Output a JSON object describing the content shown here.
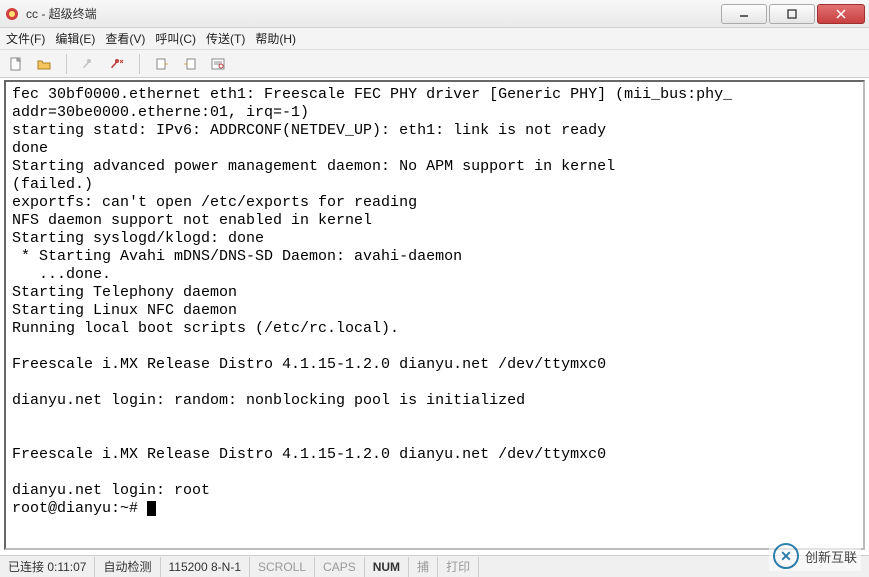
{
  "window": {
    "title": "cc - 超级终端"
  },
  "menu": {
    "file": "文件(F)",
    "edit": "编辑(E)",
    "view": "查看(V)",
    "call": "呼叫(C)",
    "transfer": "传送(T)",
    "help": "帮助(H)"
  },
  "terminal": {
    "content": "fec 30bf0000.ethernet eth1: Freescale FEC PHY driver [Generic PHY] (mii_bus:phy_\naddr=30be0000.etherne:01, irq=-1)\nstarting statd: IPv6: ADDRCONF(NETDEV_UP): eth1: link is not ready\ndone\nStarting advanced power management daemon: No APM support in kernel\n(failed.)\nexportfs: can't open /etc/exports for reading\nNFS daemon support not enabled in kernel\nStarting syslogd/klogd: done\n * Starting Avahi mDNS/DNS-SD Daemon: avahi-daemon\n   ...done.\nStarting Telephony daemon\nStarting Linux NFC daemon\nRunning local boot scripts (/etc/rc.local).\n\nFreescale i.MX Release Distro 4.1.15-1.2.0 dianyu.net /dev/ttymxc0\n\ndianyu.net login: random: nonblocking pool is initialized\n\n\nFreescale i.MX Release Distro 4.1.15-1.2.0 dianyu.net /dev/ttymxc0\n\ndianyu.net login: root\nroot@dianyu:~# "
  },
  "status": {
    "connected": "已连接 0:11:07",
    "autodetect": "自动检测",
    "baud": "115200 8-N-1",
    "scroll": "SCROLL",
    "caps": "CAPS",
    "num": "NUM",
    "capture": "捕",
    "print": "打印"
  },
  "watermark": {
    "text": "创新互联"
  }
}
